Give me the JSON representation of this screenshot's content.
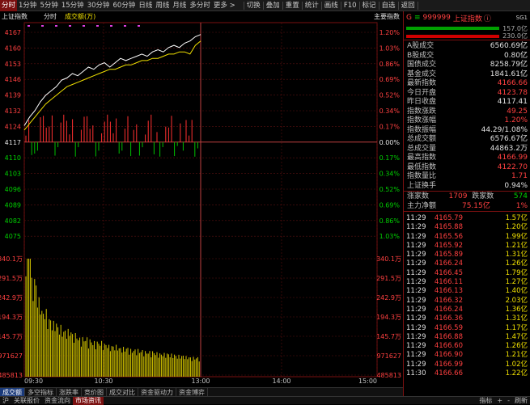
{
  "toolbar": {
    "left": [
      "分时",
      "1分钟",
      "5分钟",
      "15分钟",
      "30分钟",
      "60分钟",
      "日线",
      "周线",
      "月线",
      "多分时",
      "更多 >"
    ],
    "mid": [
      "切换",
      "叠加",
      "重置",
      "统计",
      "画线",
      "F10",
      "标记",
      "自选",
      "返回"
    ]
  },
  "chart": {
    "title": "上证指数",
    "mode": "分时",
    "volume_label": "成交额(万)",
    "badge": "主要指数",
    "price_ticks": [
      "4167",
      "4160",
      "4153",
      "4146",
      "4139",
      "4132",
      "4124",
      "4117",
      "4110",
      "4103",
      "4096",
      "4089",
      "4082",
      "4075"
    ],
    "pct_ticks": [
      "1.20%",
      "1.03%",
      "0.86%",
      "0.69%",
      "0.52%",
      "0.34%",
      "0.17%",
      "0.00%",
      "0.17%",
      "0.34%",
      "0.52%",
      "0.69%",
      "0.86%",
      "1.03%"
    ],
    "vol_ticks": [
      "340.1万",
      "291.5万",
      "242.9万",
      "194.3万",
      "145.7万",
      "971627",
      "485813"
    ],
    "time_ticks": [
      "09:30",
      "10:30",
      "13:00",
      "14:00",
      "15:00"
    ],
    "prev_close": 4117.41,
    "price_line_color": "#ffffff",
    "avg_line_color": "#f0e000"
  },
  "chart_data": {
    "type": "line",
    "title": "上证指数",
    "ylim": [
      4075,
      4167
    ],
    "series": [
      {
        "name": "price",
        "values": [
          4124,
          4128,
          4131,
          4135,
          4138,
          4140,
          4142,
          4145,
          4146,
          4148,
          4147,
          4149,
          4151,
          4150,
          4152,
          4153,
          4151,
          4153,
          4155,
          4154,
          4155,
          4156,
          4157,
          4156,
          4158,
          4159,
          4158,
          4160,
          4161,
          4160,
          4162,
          4163,
          4165,
          4166
        ]
      },
      {
        "name": "avg",
        "values": [
          4122,
          4125,
          4128,
          4131,
          4134,
          4136,
          4138,
          4140,
          4142,
          4143,
          4144,
          4145,
          4146,
          4147,
          4148,
          4149,
          4150,
          4150,
          4151,
          4152,
          4152,
          4153,
          4154,
          4154,
          4155,
          4155,
          4156,
          4157,
          4157,
          4158,
          4158,
          4157,
          4161,
          4163
        ]
      }
    ],
    "volume": [
      3.4,
      2.5,
      2.0,
      1.7,
      1.5,
      1.4,
      1.3,
      1.2,
      1.2,
      1.1,
      1.0,
      1.0,
      0.95,
      0.9,
      0.9,
      0.85,
      0.8,
      0.8,
      0.75,
      0.75,
      0.7,
      0.7,
      0.68,
      0.65,
      0.65,
      0.62,
      0.6,
      0.6,
      0.58,
      0.55,
      0.55,
      0.52,
      0.5,
      0.5
    ]
  },
  "panel": {
    "code": "999999",
    "name": "上证指数",
    "tag": "SG1",
    "bar_top": "157.0亿",
    "bar_bottom": "230.0亿",
    "stats": [
      {
        "label": "A股成交",
        "value": "6560.69亿",
        "color": "white"
      },
      {
        "label": "B股成交",
        "value": "0.80亿",
        "color": "white"
      },
      {
        "label": "国债成交",
        "value": "8258.79亿",
        "color": "white"
      },
      {
        "label": "基金成交",
        "value": "1841.61亿",
        "color": "white"
      },
      {
        "label": "最新指数",
        "value": "4166.66",
        "color": "red"
      },
      {
        "label": "今日开盘",
        "value": "4123.78",
        "color": "red"
      },
      {
        "label": "昨日收盘",
        "value": "4117.41",
        "color": "white"
      },
      {
        "label": "指数涨跌",
        "value": "49.25",
        "color": "red"
      },
      {
        "label": "指数涨幅",
        "value": "1.20%",
        "color": "red"
      },
      {
        "label": "指数振幅",
        "value": "44.29/1.08%",
        "color": "white"
      },
      {
        "label": "总成交额",
        "value": "6576.67亿",
        "color": "white"
      },
      {
        "label": "总成交量",
        "value": "44863.2万",
        "color": "white"
      },
      {
        "label": "最高指数",
        "value": "4166.99",
        "color": "red"
      },
      {
        "label": "最低指数",
        "value": "4122.70",
        "color": "red"
      },
      {
        "label": "指数量比",
        "value": "1.71",
        "color": "red"
      },
      {
        "label": "上证换手",
        "value": "0.94%",
        "color": "white"
      }
    ],
    "rise_label": "涨家数",
    "rise_count": "1709",
    "fall_label": "跌家数",
    "fall_count": "574",
    "netflow_label": "主力净额",
    "netflow_value": "75.15亿",
    "netflow_pct": "1%",
    "ticks": [
      [
        "11:29",
        "4165.79",
        "1.57亿"
      ],
      [
        "11:29",
        "4165.88",
        "1.20亿"
      ],
      [
        "11:29",
        "4165.56",
        "1.99亿"
      ],
      [
        "11:29",
        "4165.92",
        "1.21亿"
      ],
      [
        "11:29",
        "4165.89",
        "1.31亿"
      ],
      [
        "11:29",
        "4166.24",
        "1.26亿"
      ],
      [
        "11:29",
        "4166.45",
        "1.79亿"
      ],
      [
        "11:29",
        "4166.11",
        "1.27亿"
      ],
      [
        "11:29",
        "4166.13",
        "1.40亿"
      ],
      [
        "11:29",
        "4166.32",
        "2.03亿"
      ],
      [
        "11:29",
        "4166.24",
        "1.36亿"
      ],
      [
        "11:29",
        "4166.36",
        "1.31亿"
      ],
      [
        "11:29",
        "4166.59",
        "1.17亿"
      ],
      [
        "11:29",
        "4166.88",
        "1.47亿"
      ],
      [
        "11:29",
        "4166.60",
        "1.26亿"
      ],
      [
        "11:29",
        "4166.90",
        "1.21亿"
      ],
      [
        "11:29",
        "4166.99",
        "1.02亿"
      ],
      [
        "11:30",
        "4166.66",
        "1.22亿"
      ]
    ]
  },
  "indicator_tabs": [
    "成交额",
    "多空指标",
    "涨跌率",
    "竞价图",
    "成交对比",
    "资金驱动力",
    "资金博弈"
  ],
  "bottom_tabs": [
    "沪",
    "关联报价",
    "资金流向",
    "市场资讯"
  ],
  "bottom_right": [
    "指标",
    "+",
    "-",
    "刷新"
  ]
}
